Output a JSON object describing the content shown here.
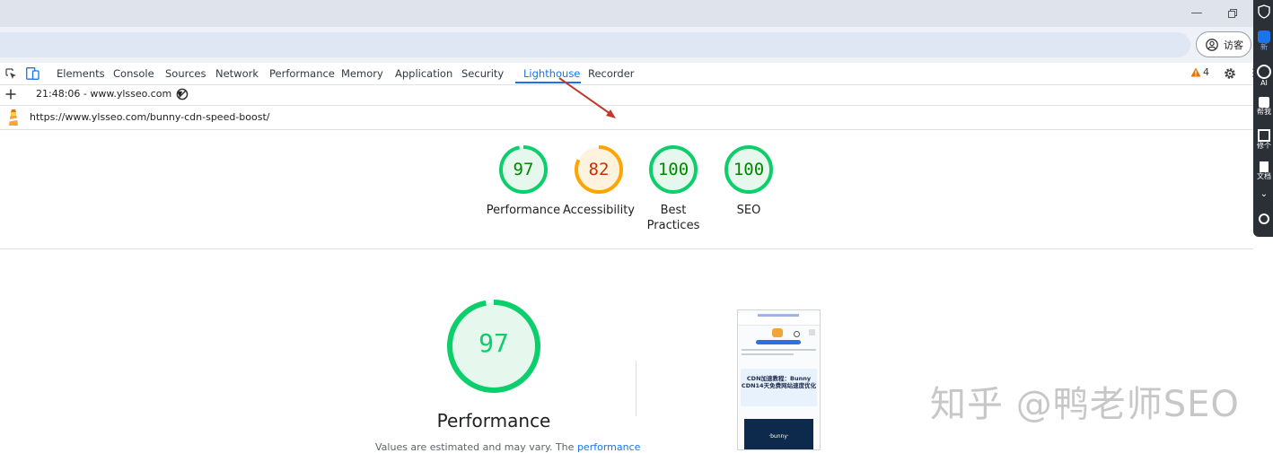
{
  "browser": {
    "guest_label": "访客"
  },
  "devtools": {
    "tabs": [
      "Elements",
      "Console",
      "Sources",
      "Network",
      "Performance",
      "Memory",
      "Application",
      "Security",
      "Lighthouse",
      "Recorder"
    ],
    "active_tab": "Lighthouse",
    "warning_count": "4"
  },
  "lighthouse": {
    "report_selector": "21:48:06 - www.ylsseo.com",
    "url": "https://www.ylsseo.com/bunny-cdn-speed-boost/",
    "scores": [
      {
        "label": "Performance",
        "value": "97",
        "status": "pass"
      },
      {
        "label": "Accessibility",
        "value": "82",
        "status": "average"
      },
      {
        "label": "Best Practices",
        "value": "100",
        "status": "pass"
      },
      {
        "label": "SEO",
        "value": "100",
        "status": "pass"
      }
    ],
    "main_score": {
      "value": "97",
      "label": "Performance"
    },
    "disclaimer_start": "Values are estimated and may vary. The",
    "disclaimer_link": "performance"
  },
  "thumbnail": {
    "article_title": "CDN加速教程：Bunny CDN14天免费网站速度优化",
    "banner_text": "·bunny·"
  },
  "sidebar": {
    "items": [
      "新",
      "AI",
      "帮我",
      "修个",
      "文档"
    ]
  },
  "watermark": "知乎 @鸭老师SEO",
  "colors": {
    "pass": "#0cce6b",
    "pass_text": "#008800",
    "pass_fill": "#e6f8ee",
    "average": "#ffa400",
    "average_text": "#c33300",
    "average_fill": "#fff3e0",
    "accent": "#1a73e8"
  }
}
